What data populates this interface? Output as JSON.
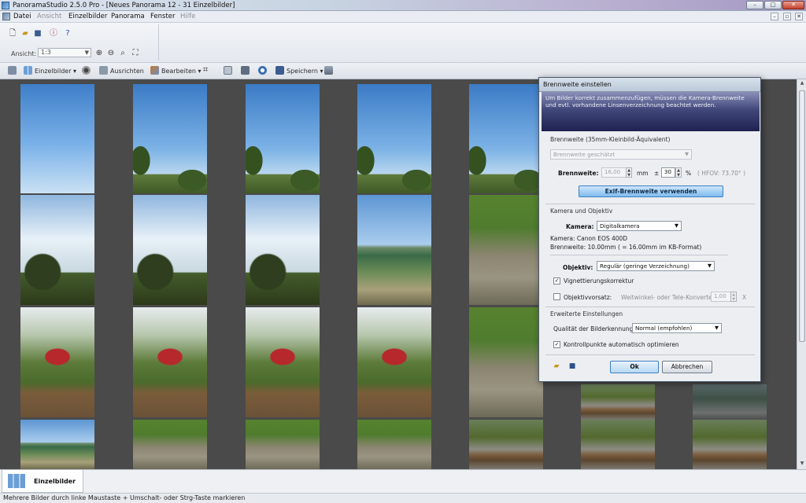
{
  "window": {
    "title": "PanoramaStudio 2.5.0 Pro - [Neues Panorama 12 - 31 Einzelbilder]",
    "controls": [
      "–",
      "□",
      "✕"
    ]
  },
  "menu": {
    "items": [
      {
        "label": "Datei",
        "enabled": true
      },
      {
        "label": "Ansicht",
        "enabled": false
      },
      {
        "label": "Einzelbilder",
        "enabled": true
      },
      {
        "label": "Panorama",
        "enabled": true
      },
      {
        "label": "Fenster",
        "enabled": true
      },
      {
        "label": "Hilfe",
        "enabled": false
      }
    ],
    "mdi_controls": [
      "–",
      "▫",
      "✕"
    ]
  },
  "toolbar": {
    "ansicht_label": "Ansicht:",
    "zoom_value": "1:3"
  },
  "main_toolbar": {
    "einzelbilder": "Einzelbilder",
    "ausrichten": "Ausrichten",
    "bearbeiten": "Bearbeiten",
    "speichern": "Speichern"
  },
  "dialog": {
    "title": "Brennweite einstellen",
    "intro": "Um Bilder korrekt zusammenzufügen, müssen die Kamera-Brennweite und evtl. vorhandene Linsenverzeichnung beachtet werden.",
    "section_focal": "Brennweite (35mm-Kleinbild-Äquivalent)",
    "focal_mode": "Brennweite geschätzt",
    "focal_label": "Brennweite:",
    "focal_value": "16,00",
    "focal_unit": "mm",
    "tolerance_prefix": "±",
    "tolerance_value": "30",
    "tolerance_unit": "%",
    "hfov": "( HFOV: 73.70° )",
    "exif_button": "Exif-Brennweite verwenden",
    "section_camera": "Kamera und Objektiv",
    "camera_label": "Kamera:",
    "camera_value": "Digitalkamera",
    "camera_info": "Kamera: Canon EOS 400D",
    "focal_info": "Brennweite: 10.00mm ( = 16.00mm im KB-Format)",
    "objektiv_label": "Objektiv:",
    "objektiv_value": "Regulär  (geringe Verzeichnung)",
    "vignette_label": "Vignettierungskorrektur",
    "vignette_checked": true,
    "vorsatz_label": "Objektivvorsatz:",
    "vorsatz_checked": false,
    "vorsatz_hint": "Weitwinkel- oder Tele-Konverter",
    "vorsatz_value": "1,00",
    "vorsatz_unit": "X",
    "section_advanced": "Erweiterte Einstellungen",
    "quality_label": "Qualität der Bilderkennung:",
    "quality_value": "Normal (empfohlen)",
    "optimize_label": "Kontrollpunkte automatisch optimieren",
    "optimize_checked": true,
    "ok": "Ok",
    "cancel": "Abbrechen"
  },
  "thumbnails": {
    "rows": [
      [
        "sky",
        "sky-tree",
        "sky-tree",
        "sky-tree",
        "sky-tree"
      ],
      [
        "bright",
        "bright",
        "bright",
        "lake",
        "path"
      ],
      [
        "garden",
        "garden",
        "garden",
        "garden",
        "path"
      ],
      [
        "lake",
        "path",
        "path",
        "path",
        "bench"
      ]
    ],
    "extra_right": [
      "bench",
      "dark"
    ]
  },
  "bottom": {
    "tab_label": "Einzelbilder",
    "status": "Mehrere Bilder durch linke Maustaste + Umschalt- oder Strg-Taste markieren"
  }
}
